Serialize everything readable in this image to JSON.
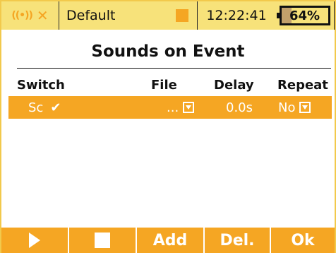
{
  "statusbar": {
    "model_name": "Default",
    "time": "12:22:41",
    "battery_percent": "64%",
    "battery_level": 0.64
  },
  "page": {
    "title": "Sounds on Event"
  },
  "table": {
    "headers": {
      "switch": "Switch",
      "file": "File",
      "delay": "Delay",
      "repeat": "Repeat"
    },
    "rows": [
      {
        "switch": "Sc",
        "check": "✔",
        "file": "...",
        "delay": "0.0s",
        "repeat": "No"
      }
    ]
  },
  "buttons": {
    "add": "Add",
    "delete": "Del.",
    "ok": "Ok"
  },
  "colors": {
    "accent": "#f5a623",
    "statusbar_bg": "#f7e27a"
  }
}
